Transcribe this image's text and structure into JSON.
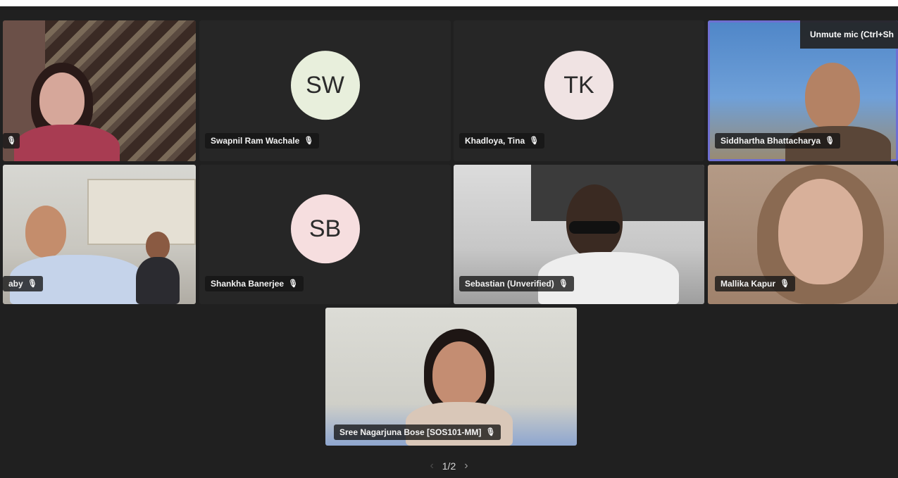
{
  "tooltip": {
    "text": "Unmute mic (Ctrl+Sh"
  },
  "mic_icon": "microphone-muted-icon",
  "participants": {
    "p1": {
      "name": "",
      "mic": "🎙"
    },
    "sw": {
      "initials": "SW",
      "name": "Swapnil Ram Wachale",
      "mic": "🎙",
      "avatar_color": "#e8efdc"
    },
    "tk": {
      "initials": "TK",
      "name": "Khadloya, Tina",
      "mic": "🎙",
      "avatar_color": "#f0e3e3"
    },
    "siddhartha": {
      "name": "Siddhartha Bhattacharya",
      "mic": "🎙"
    },
    "p5": {
      "name": "aby",
      "mic": "🎙"
    },
    "sb": {
      "initials": "SB",
      "name": "Shankha Banerjee",
      "mic": "🎙",
      "avatar_color": "#f6dedf"
    },
    "sebastian": {
      "name": "Sebastian (Unverified)",
      "mic": "🎙"
    },
    "mallika": {
      "name": "Mallika Kapur",
      "mic": "🎙"
    },
    "sree": {
      "name": "Sree Nagarjuna Bose [SOS101-MM]",
      "mic": "🎙"
    }
  },
  "pagination": {
    "label": "1/2",
    "prev": "‹",
    "next": "›"
  }
}
